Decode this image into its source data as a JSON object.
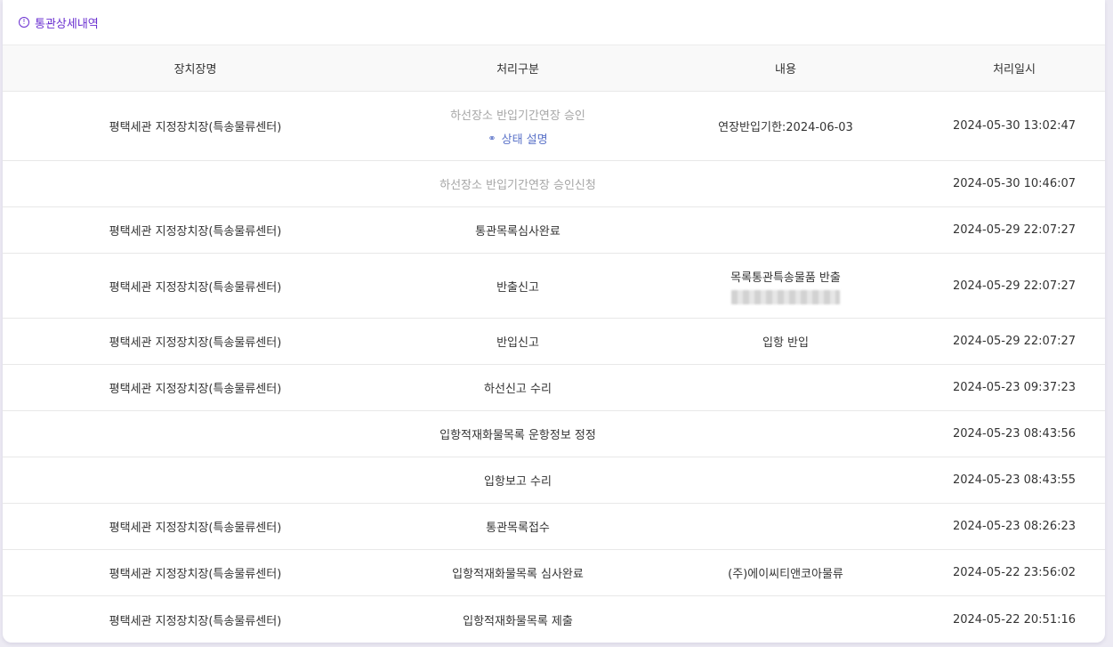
{
  "section": {
    "title": "통관상세내역",
    "icon": "info-circle-icon",
    "accent": "#6a2fd0"
  },
  "columns": [
    "장치장명",
    "처리구분",
    "내용",
    "처리일시"
  ],
  "status_link": {
    "label": "상태 설명",
    "icon": "link-icon"
  },
  "rows": [
    {
      "place": "평택세관 지정장치장(특송물류센터)",
      "type": "하선장소 반입기간연장 승인",
      "content": "연장반입기한:2024-06-03",
      "datetime": "2024-05-30 13:02:47"
    },
    {
      "place": "",
      "type": "하선장소 반입기간연장 승인신청",
      "content": "",
      "datetime": "2024-05-30 10:46:07"
    },
    {
      "place": "평택세관 지정장치장(특송물류센터)",
      "type": "통관목록심사완료",
      "content": "",
      "datetime": "2024-05-29 22:07:27"
    },
    {
      "place": "평택세관 지정장치장(특송물류센터)",
      "type": "반출신고",
      "content": "목록통관특송물품 반출",
      "datetime": "2024-05-29 22:07:27"
    },
    {
      "place": "평택세관 지정장치장(특송물류센터)",
      "type": "반입신고",
      "content": "입항 반입",
      "datetime": "2024-05-29 22:07:27"
    },
    {
      "place": "평택세관 지정장치장(특송물류센터)",
      "type": "하선신고 수리",
      "content": "",
      "datetime": "2024-05-23 09:37:23"
    },
    {
      "place": "",
      "type": "입항적재화물목록 운항정보 정정",
      "content": "",
      "datetime": "2024-05-23 08:43:56"
    },
    {
      "place": "",
      "type": "입항보고 수리",
      "content": "",
      "datetime": "2024-05-23 08:43:55"
    },
    {
      "place": "평택세관 지정장치장(특송물류센터)",
      "type": "통관목록접수",
      "content": "",
      "datetime": "2024-05-23 08:26:23"
    },
    {
      "place": "평택세관 지정장치장(특송물류센터)",
      "type": "입항적재화물목록 심사완료",
      "content": "(주)에이씨티앤코아물류",
      "datetime": "2024-05-22 23:56:02"
    },
    {
      "place": "평택세관 지정장치장(특송물류센터)",
      "type": "입항적재화물목록 제출",
      "content": "",
      "datetime": "2024-05-22 20:51:16"
    }
  ]
}
